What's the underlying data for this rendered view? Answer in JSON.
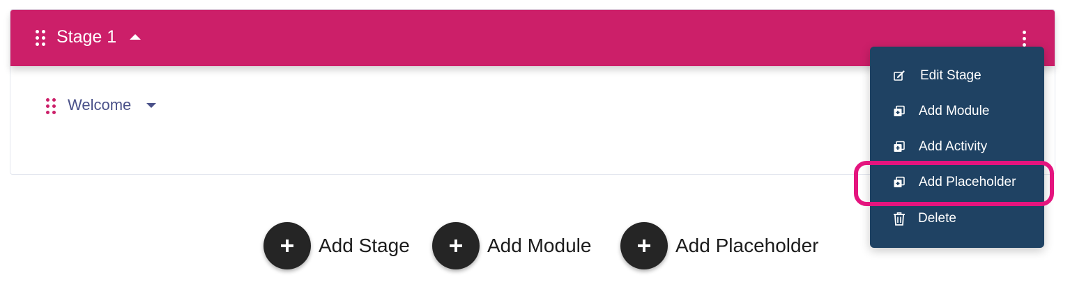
{
  "stage": {
    "title": "Stage 1",
    "expanded": true
  },
  "module": {
    "title": "Welcome",
    "expanded": false
  },
  "stage_menu": {
    "items": [
      {
        "label": "Edit Stage",
        "icon": "edit-icon"
      },
      {
        "label": "Add Module",
        "icon": "add-copy-icon"
      },
      {
        "label": "Add Activity",
        "icon": "add-copy-icon"
      },
      {
        "label": "Add Placeholder",
        "icon": "add-copy-icon",
        "highlighted": true
      },
      {
        "label": "Delete",
        "icon": "trash-icon"
      }
    ]
  },
  "actions": {
    "add_stage": "Add Stage",
    "add_module": "Add Module",
    "add_placeholder": "Add Placeholder"
  },
  "colors": {
    "stage_header": "#cc1f69",
    "menu_background": "#1f4263",
    "highlight_ring": "#e4147e",
    "module_title": "#4a5189",
    "add_button": "#252525"
  }
}
